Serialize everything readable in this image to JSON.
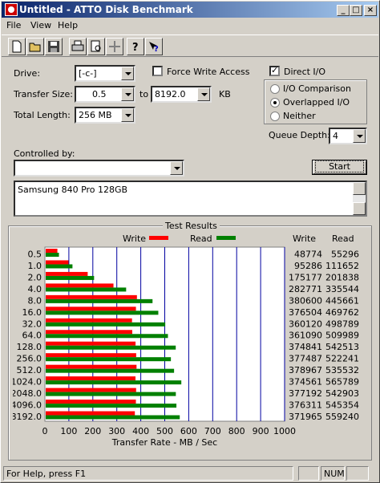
{
  "window": {
    "title": "Untitled - ATTO Disk Benchmark"
  },
  "menu": [
    "File",
    "View",
    "Help"
  ],
  "toolbar": {
    "icons": [
      "new-file-icon",
      "open-folder-icon",
      "save-icon",
      "print-icon",
      "print-preview-icon",
      "move-icon",
      "help-icon",
      "context-help-icon"
    ]
  },
  "settings": {
    "drive_label": "Drive:",
    "drive_value": "[-c-]",
    "transfer_size_label": "Transfer Size:",
    "transfer_from": "0.5",
    "to_label": "to",
    "transfer_to": "8192.0",
    "kb_label": "KB",
    "total_length_label": "Total Length:",
    "total_length_value": "256 MB",
    "force_write_label": "Force Write Access",
    "force_write_checked": false,
    "direct_io_label": "Direct I/O",
    "direct_io_checked": true,
    "io_comparison_label": "I/O Comparison",
    "overlapped_label": "Overlapped I/O",
    "neither_label": "Neither",
    "selected_mode": "overlapped",
    "queue_depth_label": "Queue Depth:",
    "queue_depth_value": "4",
    "controlled_by_label": "Controlled by:",
    "controlled_by_value": "",
    "start_label": "Start",
    "description": "Samsung 840 Pro 128GB"
  },
  "results": {
    "title": "Test Results",
    "write_legend": "Write",
    "read_legend": "Read",
    "write_header": "Write",
    "read_header": "Read",
    "write_color": "#ff0000",
    "read_color": "#008000"
  },
  "chart_data": {
    "type": "bar",
    "orientation": "horizontal",
    "title": "Test Results",
    "xlabel": "Transfer Rate - MB / Sec",
    "xlim": [
      0,
      1000
    ],
    "xticks": [
      0,
      100,
      200,
      300,
      400,
      500,
      600,
      700,
      800,
      900,
      1000
    ],
    "categories": [
      "0.5",
      "1.0",
      "2.0",
      "4.0",
      "8.0",
      "16.0",
      "32.0",
      "64.0",
      "128.0",
      "256.0",
      "512.0",
      "1024.0",
      "2048.0",
      "4096.0",
      "8192.0"
    ],
    "series": [
      {
        "name": "Write",
        "color": "#ff0000",
        "values": [
          48.774,
          95.286,
          175.177,
          282.771,
          380.6,
          376.504,
          360.12,
          361.09,
          374.841,
          377.487,
          378.967,
          374.561,
          377.192,
          376.311,
          371.965
        ]
      },
      {
        "name": "Read",
        "color": "#008000",
        "values": [
          55.296,
          111.652,
          201.838,
          335.544,
          445.661,
          469.762,
          498.789,
          509.989,
          542.513,
          522.241,
          535.532,
          565.789,
          542.903,
          545.354,
          559.24
        ]
      }
    ],
    "table_write": [
      "48774",
      "95286",
      "175177",
      "282771",
      "380600",
      "376504",
      "360120",
      "361090",
      "374841",
      "377487",
      "378967",
      "374561",
      "377192",
      "376311",
      "371965"
    ],
    "table_read": [
      "55296",
      "111652",
      "201838",
      "335544",
      "445661",
      "469762",
      "498789",
      "509989",
      "542513",
      "522241",
      "535532",
      "565789",
      "542903",
      "545354",
      "559240"
    ]
  },
  "status": {
    "text": "For Help, press F1",
    "num": "NUM"
  }
}
